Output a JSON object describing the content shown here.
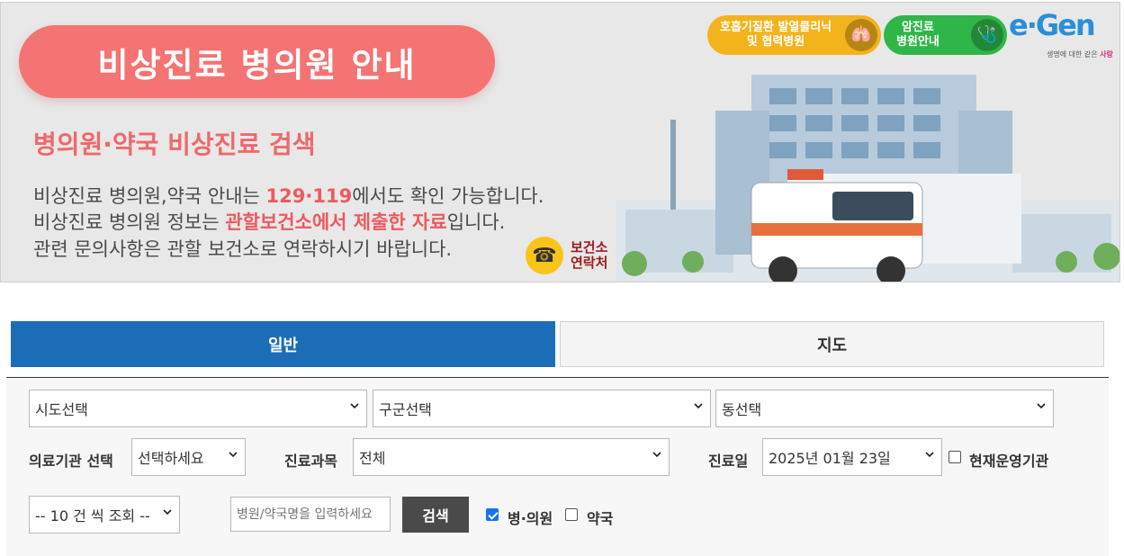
{
  "banner": {
    "title": "비상진료 병의원 안내",
    "subtitle": "병의원·약국 비상진료 검색",
    "line1_pre": "비상진료 병의원,약국 안내는 ",
    "line1_hl": "129·119",
    "line1_post": "에서도 확인 가능합니다.",
    "line2_pre": "비상진료 병의원 정보는 ",
    "line2_hl": "관할보건소에서 제출한 자료",
    "line2_post": "입니다.",
    "line3": "관련 문의사항은 관할 보건소로 연락하시기 바랍니다.",
    "contact_line1": "보건소",
    "contact_line2": "연락처",
    "resp_btn_line1": "호흡기질환 발열클리닉",
    "resp_btn_line2": "및 협력병원",
    "cancer_btn_line1": "암진료",
    "cancer_btn_line2": "병원안내",
    "logo_text": "e·Gen",
    "logo_tag_pre": "생명에 대한 같은 ",
    "logo_tag_hl": "사랑",
    "colors": {
      "title_bg": "#f47373",
      "highlight": "#ec5a5f",
      "resp_btn": "#f3b31b",
      "cancer_btn": "#2fb648"
    }
  },
  "tabs": {
    "general": "일반",
    "map": "지도",
    "active_color": "#1b6db8"
  },
  "form": {
    "sido": "시도선택",
    "gugun": "구군선택",
    "dong": "동선택",
    "institution_label": "의료기관 선택",
    "institution_value": "선택하세요",
    "dept_label": "진료과목",
    "dept_value": "전체",
    "date_label": "진료일",
    "date_value": "2025년 01월 23일",
    "open_now_label": "현재운영기관",
    "page_size": "-- 10 건 씩 조회 --",
    "search_placeholder": "병원/약국명을 입력하세요",
    "search_button": "검색",
    "hospital_label": "병·의원",
    "pharmacy_label": "약국"
  }
}
